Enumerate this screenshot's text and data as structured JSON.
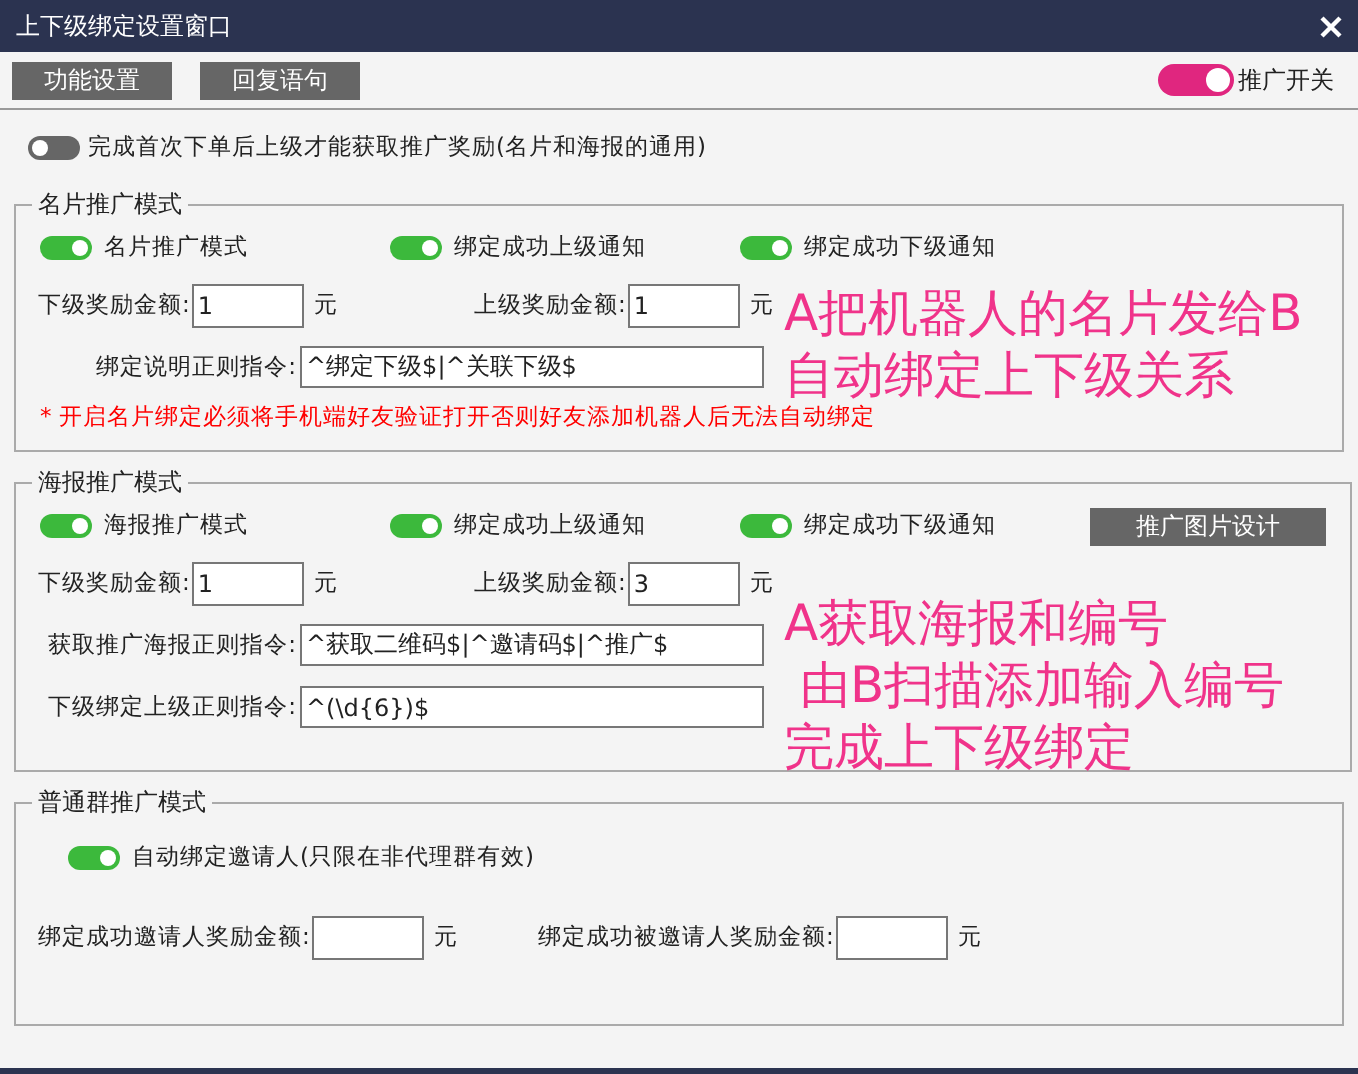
{
  "window": {
    "title": "上下级绑定设置窗口"
  },
  "toolbar": {
    "buttons": [
      "功能设置",
      "回复语句"
    ],
    "master_switch": {
      "label": "推广开关",
      "on": true
    }
  },
  "first_order_rule": {
    "label": "完成首次下单后上级才能获取推广奖励(名片和海报的通用)",
    "on": false
  },
  "sections": [
    {
      "title": "名片推广模式",
      "toggles": [
        {
          "label": "名片推广模式",
          "on": true
        },
        {
          "label": "绑定成功上级通知",
          "on": true
        },
        {
          "label": "绑定成功下级通知",
          "on": true
        }
      ],
      "rows": [
        {
          "kind": "amounts",
          "items": [
            {
              "label": "下级奖励金额:",
              "value": "1",
              "unit": "元"
            },
            {
              "label": "上级奖励金额:",
              "value": "1",
              "unit": "元"
            }
          ]
        },
        {
          "kind": "regex",
          "label": "绑定说明正则指令:",
          "value": "^绑定下级$|^关联下级$"
        }
      ],
      "note": "* 开启名片绑定必须将手机端好友验证打开否则好友添加机器人后无法自动绑定",
      "annotation": [
        "A把机器人的名片发给B",
        "自动绑定上下级关系"
      ]
    },
    {
      "title": "海报推广模式",
      "toggles": [
        {
          "label": "海报推广模式",
          "on": true
        },
        {
          "label": "绑定成功上级通知",
          "on": true
        },
        {
          "label": "绑定成功下级通知",
          "on": true
        }
      ],
      "button": "推广图片设计",
      "rows": [
        {
          "kind": "amounts",
          "items": [
            {
              "label": "下级奖励金额:",
              "value": "1",
              "unit": "元"
            },
            {
              "label": "上级奖励金额:",
              "value": "3",
              "unit": "元"
            }
          ]
        },
        {
          "kind": "regex",
          "label": "获取推广海报正则指令:",
          "value": "^获取二维码$|^邀请码$|^推广$"
        },
        {
          "kind": "regex",
          "label": "下级绑定上级正则指令:",
          "value": "^(\\d{6})$"
        }
      ],
      "annotation": [
        "A获取海报和编号",
        " 由B扫描添加输入编号",
        "完成上下级绑定"
      ]
    },
    {
      "title": "普通群推广模式",
      "toggles": [
        {
          "label": "自动绑定邀请人(只限在非代理群有效)",
          "on": true
        }
      ],
      "rows": [
        {
          "kind": "amounts",
          "items": [
            {
              "label": "绑定成功邀请人奖励金额:",
              "unit": "元"
            },
            {
              "label": "绑定成功被邀请人奖励金额:",
              "unit": "元"
            }
          ]
        }
      ]
    }
  ]
}
